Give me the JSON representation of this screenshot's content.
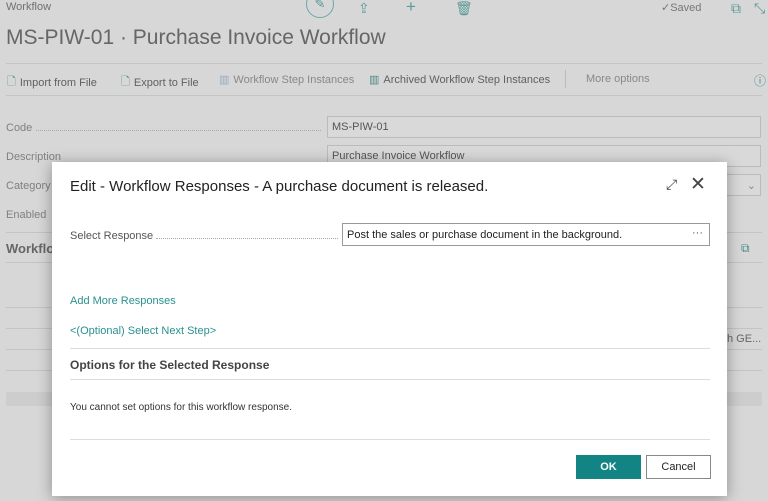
{
  "header": {
    "breadcrumb": "Workflow",
    "title": "MS-PIW-01 · Purchase Invoice Workflow",
    "saved": "✓Saved"
  },
  "actions": [
    {
      "label": "Import from File",
      "icon": "import-icon"
    },
    {
      "label": "Export to File",
      "icon": "export-icon"
    },
    {
      "label": "Workflow Step Instances",
      "icon": "table-icon"
    },
    {
      "label": "Archived Workflow Step Instances",
      "icon": "table-icon"
    },
    {
      "label": "More options"
    }
  ],
  "fields": {
    "code_label": "Code",
    "code_value": "MS-PIW-01",
    "description_label": "Description",
    "description_value": "Purchase Invoice Workflow",
    "category_label": "Category",
    "enabled_label": "Enabled"
  },
  "steps": {
    "title": "Workflow",
    "cell": "h GE..."
  },
  "dialog": {
    "title": "Edit - Workflow Responses - A purchase document is released.",
    "select_response_label": "Select Response",
    "select_response_value": "Post the sales or purchase document in the background.",
    "add_more": "Add More Responses",
    "next_step": "<(Optional) Select Next Step>",
    "options_title": "Options for the Selected Response",
    "options_text": "You cannot set options for this workflow response.",
    "ok": "OK",
    "cancel": "Cancel"
  },
  "colors": {
    "accent": "#138484"
  }
}
